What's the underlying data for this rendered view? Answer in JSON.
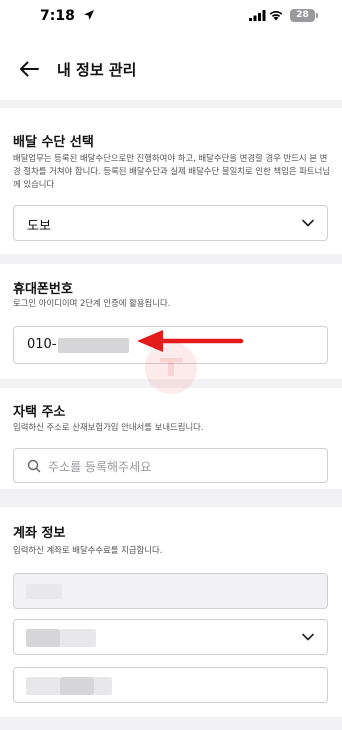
{
  "status_bar": {
    "time": "7:18",
    "battery": "28"
  },
  "header": {
    "title": "내 정보 관리"
  },
  "delivery": {
    "title": "배달 수단 선택",
    "desc": "배달업무는 등록된 배달수단으로만 진행하여야 하고, 배달수단을 변경할 경우 반드시 본 변경 절차를 거쳐야 합니다. 등록된 배달수단과 실제 배달수단 불일치로 인한 책임은 파트너님께 있습니다",
    "selected": "도보"
  },
  "phone": {
    "title": "휴대폰번호",
    "desc": "로그인 아이디이며 2단계 인증에 활용됩니다.",
    "value_prefix": "010-"
  },
  "address": {
    "title": "자택 주소",
    "desc": "입력하신 주소로 산재보험가입 안내서를 보내드립니다.",
    "placeholder": "주소를 등록해주세요"
  },
  "account": {
    "title": "계좌 정보",
    "desc": "입력하신 계좌로 배달수수료를 지급합니다."
  },
  "colors": {
    "accent_arrow": "#e41b1b",
    "background": "#f2f2f4"
  }
}
